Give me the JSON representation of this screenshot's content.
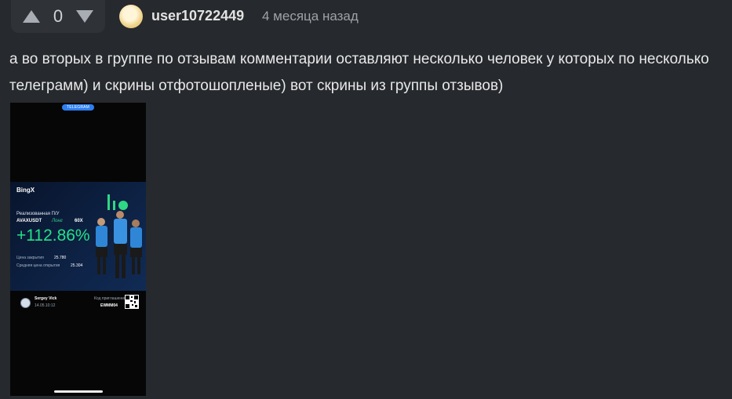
{
  "vote": {
    "count": "0"
  },
  "author": {
    "username": "user10722449",
    "time": "4 месяца назад"
  },
  "comment": {
    "text": "а во вторых в группе по отзывам комментарии оставляют несколько человек у которых по несколько телеграмм) и скрины отфотошопленые) вот скрины из группы отзывов)"
  },
  "screenshot": {
    "telegram_pill": "TELEGRAM",
    "brand": "BingX",
    "pnl_label": "Реализованная П/У",
    "pair": "AVAXUSDT",
    "direction": "Лонг",
    "leverage": "60X",
    "pnl_value": "+112.86%",
    "close_price_label": "Цена закрытия",
    "close_price": "25.780",
    "open_price_label": "Средняя цена открытия",
    "open_price": "25.304",
    "user_name": "Sergey Vick",
    "date": "14.05.10:12",
    "invite_label": "Код приглашения",
    "invite_code": "EWMM04"
  },
  "colors": {
    "background": "#26292d",
    "vote_box": "#2f3237",
    "pnl_green": "#22e28a",
    "telegram_blue": "#2d7ff0"
  }
}
